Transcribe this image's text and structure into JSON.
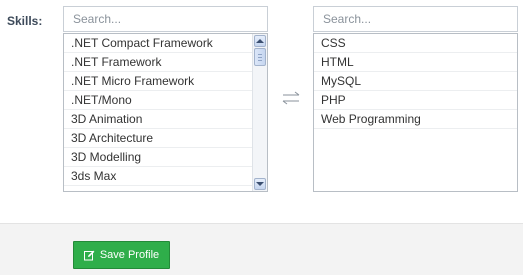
{
  "form": {
    "skills_label": "Skills:"
  },
  "available": {
    "search_placeholder": "Search...",
    "items": [
      ".NET Compact Framework",
      ".NET Framework",
      ".NET Micro Framework",
      ".NET/Mono",
      "3D Animation",
      "3D Architecture",
      "3D Modelling",
      "3ds Max"
    ]
  },
  "selected": {
    "search_placeholder": "Search...",
    "items": [
      "CSS",
      "HTML",
      "MySQL",
      "PHP",
      "Web Programming"
    ]
  },
  "icons": {
    "swap": "swap-arrows-icon",
    "save": "edit-icon"
  },
  "footer": {
    "save_label": "Save Profile"
  },
  "colors": {
    "save_button": "#2fae4a",
    "footer_background": "#f3f3f3"
  }
}
